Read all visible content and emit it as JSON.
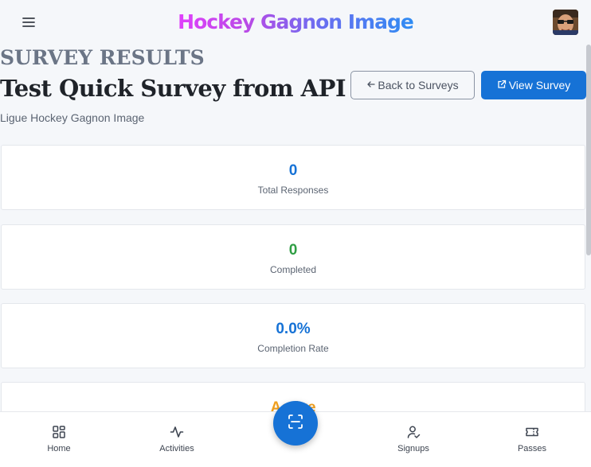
{
  "header": {
    "logo_text": "Hockey Gagnon Image",
    "menu_icon": "hamburger-menu-icon",
    "avatar": "user-avatar"
  },
  "page": {
    "eyebrow": "SURVEY RESULTS",
    "title": "Test Quick Survey from API",
    "subtitle": "Ligue Hockey Gagnon Image"
  },
  "actions": {
    "back_label": "Back to Surveys",
    "back_icon": "arrow-left-icon",
    "view_label": "View Survey",
    "view_icon": "external-link-icon"
  },
  "stats": [
    {
      "value": "0",
      "label": "Total Responses",
      "color": "#1672d6"
    },
    {
      "value": "0",
      "label": "Completed",
      "color": "#2f9e44"
    },
    {
      "value": "0.0%",
      "label": "Completion Rate",
      "color": "#1672d6"
    },
    {
      "value": "Active",
      "label": "",
      "color": "#f0a020"
    }
  ],
  "nav": {
    "items": [
      {
        "label": "Home",
        "icon": "dashboard-icon"
      },
      {
        "label": "Activities",
        "icon": "activity-icon"
      },
      {
        "label": "Signups",
        "icon": "user-check-icon"
      },
      {
        "label": "Passes",
        "icon": "ticket-icon"
      }
    ],
    "scan_icon": "scan-icon"
  },
  "colors": {
    "primary": "#1672d6",
    "success": "#2f9e44",
    "warning": "#f0a020",
    "background": "#f5f7fa"
  }
}
